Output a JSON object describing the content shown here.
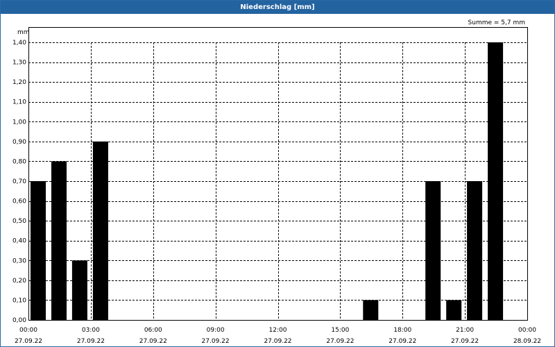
{
  "title": "Niederschlag [mm]",
  "summary": "Summe = 5,7 mm",
  "colors": {
    "titlebar": "#2363a0",
    "bar": "#000000",
    "grid": "#000000"
  },
  "chart_data": {
    "type": "bar",
    "title": "Niederschlag [mm]",
    "ylabel": "mm",
    "xlabel": "",
    "ylim": [
      0,
      1.4
    ],
    "yticks": [
      "0,00",
      "0,10",
      "0,20",
      "0,30",
      "0,40",
      "0,50",
      "0,60",
      "0,70",
      "0,80",
      "0,90",
      "1,00",
      "1,10",
      "1,20",
      "1,30",
      "1,40"
    ],
    "xlim_hours": [
      0,
      24
    ],
    "xticks": [
      {
        "time": "00:00",
        "date": "27.09.22",
        "hour": 0
      },
      {
        "time": "03:00",
        "date": "27.09.22",
        "hour": 3
      },
      {
        "time": "06:00",
        "date": "27.09.22",
        "hour": 6
      },
      {
        "time": "09:00",
        "date": "27.09.22",
        "hour": 9
      },
      {
        "time": "12:00",
        "date": "27.09.22",
        "hour": 12
      },
      {
        "time": "15:00",
        "date": "27.09.22",
        "hour": 15
      },
      {
        "time": "18:00",
        "date": "27.09.22",
        "hour": 18
      },
      {
        "time": "21:00",
        "date": "27.09.22",
        "hour": 21
      },
      {
        "time": "00:00",
        "date": "28.09.22",
        "hour": 24
      }
    ],
    "bars": [
      {
        "hour": 0,
        "value": 0.7
      },
      {
        "hour": 1,
        "value": 0.8
      },
      {
        "hour": 2,
        "value": 0.3
      },
      {
        "hour": 3,
        "value": 0.9
      },
      {
        "hour": 4,
        "value": 0
      },
      {
        "hour": 5,
        "value": 0
      },
      {
        "hour": 6,
        "value": 0
      },
      {
        "hour": 7,
        "value": 0
      },
      {
        "hour": 8,
        "value": 0
      },
      {
        "hour": 9,
        "value": 0
      },
      {
        "hour": 10,
        "value": 0
      },
      {
        "hour": 11,
        "value": 0
      },
      {
        "hour": 12,
        "value": 0
      },
      {
        "hour": 13,
        "value": 0
      },
      {
        "hour": 14,
        "value": 0
      },
      {
        "hour": 15,
        "value": 0
      },
      {
        "hour": 16,
        "value": 0.1
      },
      {
        "hour": 17,
        "value": 0
      },
      {
        "hour": 18,
        "value": 0
      },
      {
        "hour": 19,
        "value": 0.7
      },
      {
        "hour": 20,
        "value": 0.1
      },
      {
        "hour": 21,
        "value": 0.7
      },
      {
        "hour": 22,
        "value": 1.4
      },
      {
        "hour": 23,
        "value": 0
      }
    ],
    "grid": true,
    "legend": "none"
  }
}
